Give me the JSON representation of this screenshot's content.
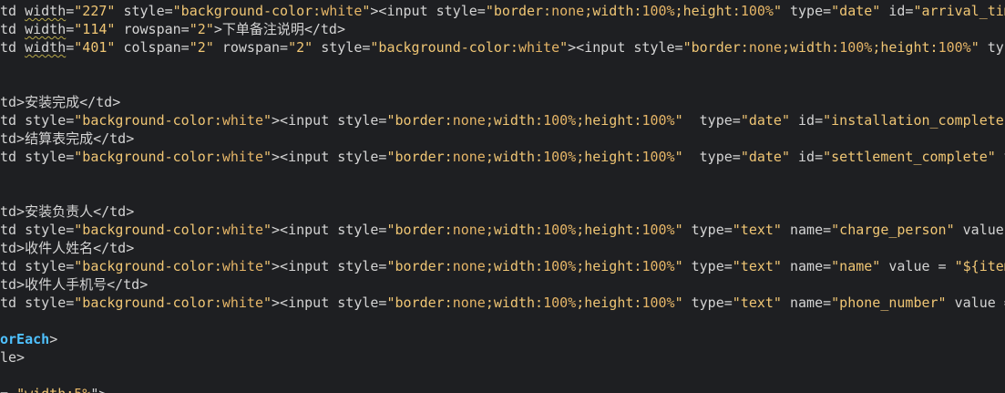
{
  "editor": {
    "background": "#1e1f22",
    "colors": {
      "default": "#d4d4d4",
      "string": "#f0c674",
      "jstl_tag": "#4fc1ff"
    },
    "lines": [
      {
        "row": 0,
        "tokens": [
          {
            "t": "td ",
            "c": "tag"
          },
          {
            "t": "width",
            "c": "attr",
            "squiggle": true
          },
          {
            "t": "=",
            "c": "tag"
          },
          {
            "t": "\"227\"",
            "c": "str"
          },
          {
            "t": " style=",
            "c": "attr"
          },
          {
            "t": "\"background-color:",
            "c": "str"
          },
          {
            "t": "white",
            "c": "kw"
          },
          {
            "t": "\"",
            "c": "str"
          },
          {
            "t": "><input style=",
            "c": "tag"
          },
          {
            "t": "\"border:",
            "c": "str"
          },
          {
            "t": "none",
            "c": "kw"
          },
          {
            "t": ";width:",
            "c": "str"
          },
          {
            "t": "100%",
            "c": "kw"
          },
          {
            "t": ";height:",
            "c": "str"
          },
          {
            "t": "100%",
            "c": "kw"
          },
          {
            "t": "\"",
            "c": "str"
          },
          {
            "t": " type=",
            "c": "attr"
          },
          {
            "t": "\"date\"",
            "c": "str"
          },
          {
            "t": " id=",
            "c": "attr"
          },
          {
            "t": "\"arrival_tim",
            "c": "str"
          }
        ]
      },
      {
        "row": 1,
        "tokens": [
          {
            "t": "td ",
            "c": "tag"
          },
          {
            "t": "width",
            "c": "attr",
            "squiggle": true
          },
          {
            "t": "=",
            "c": "tag"
          },
          {
            "t": "\"114\"",
            "c": "str"
          },
          {
            "t": " rowspan=",
            "c": "attr"
          },
          {
            "t": "\"2\"",
            "c": "str"
          },
          {
            "t": ">下单备注说明</td>",
            "c": "tag"
          }
        ]
      },
      {
        "row": 2,
        "tokens": [
          {
            "t": "td ",
            "c": "tag"
          },
          {
            "t": "width",
            "c": "attr",
            "squiggle": true
          },
          {
            "t": "=",
            "c": "tag"
          },
          {
            "t": "\"401\"",
            "c": "str"
          },
          {
            "t": " colspan=",
            "c": "attr"
          },
          {
            "t": "\"2\"",
            "c": "str"
          },
          {
            "t": " rowspan=",
            "c": "attr"
          },
          {
            "t": "\"2\"",
            "c": "str"
          },
          {
            "t": " style=",
            "c": "attr"
          },
          {
            "t": "\"background-color:",
            "c": "str"
          },
          {
            "t": "white",
            "c": "kw"
          },
          {
            "t": "\"",
            "c": "str"
          },
          {
            "t": "><input style=",
            "c": "tag"
          },
          {
            "t": "\"border:",
            "c": "str"
          },
          {
            "t": "none",
            "c": "kw"
          },
          {
            "t": ";width:",
            "c": "str"
          },
          {
            "t": "100%",
            "c": "kw"
          },
          {
            "t": ";height:",
            "c": "str"
          },
          {
            "t": "100%",
            "c": "kw"
          },
          {
            "t": "\"",
            "c": "str"
          },
          {
            "t": " typ",
            "c": "attr"
          }
        ]
      },
      {
        "row": 5,
        "tokens": [
          {
            "t": "td>安装完成</td>",
            "c": "tag"
          }
        ]
      },
      {
        "row": 6,
        "tokens": [
          {
            "t": "td style=",
            "c": "tag"
          },
          {
            "t": "\"background-color:",
            "c": "str"
          },
          {
            "t": "white",
            "c": "kw"
          },
          {
            "t": "\"",
            "c": "str"
          },
          {
            "t": "><input style=",
            "c": "tag"
          },
          {
            "t": "\"border:",
            "c": "str"
          },
          {
            "t": "none",
            "c": "kw"
          },
          {
            "t": ";width:",
            "c": "str"
          },
          {
            "t": "100%",
            "c": "kw"
          },
          {
            "t": ";height:",
            "c": "str"
          },
          {
            "t": "100%",
            "c": "kw"
          },
          {
            "t": "\"",
            "c": "str"
          },
          {
            "t": "  type=",
            "c": "attr"
          },
          {
            "t": "\"date\"",
            "c": "str"
          },
          {
            "t": " id=",
            "c": "attr"
          },
          {
            "t": "\"installation_complete\"",
            "c": "str"
          }
        ]
      },
      {
        "row": 7,
        "tokens": [
          {
            "t": "td>结算表完成</td>",
            "c": "tag"
          }
        ]
      },
      {
        "row": 8,
        "tokens": [
          {
            "t": "td style=",
            "c": "tag"
          },
          {
            "t": "\"background-color:",
            "c": "str"
          },
          {
            "t": "white",
            "c": "kw"
          },
          {
            "t": "\"",
            "c": "str"
          },
          {
            "t": "><input style=",
            "c": "tag"
          },
          {
            "t": "\"border:",
            "c": "str"
          },
          {
            "t": "none",
            "c": "kw"
          },
          {
            "t": ";width:",
            "c": "str"
          },
          {
            "t": "100%",
            "c": "kw"
          },
          {
            "t": ";height:",
            "c": "str"
          },
          {
            "t": "100%",
            "c": "kw"
          },
          {
            "t": "\"",
            "c": "str"
          },
          {
            "t": "  type=",
            "c": "attr"
          },
          {
            "t": "\"date\"",
            "c": "str"
          },
          {
            "t": " id=",
            "c": "attr"
          },
          {
            "t": "\"settlement_complete\"",
            "c": "str"
          },
          {
            "t": " v",
            "c": "attr"
          }
        ]
      },
      {
        "row": 11,
        "tokens": [
          {
            "t": "td>安装负责人</td>",
            "c": "tag"
          }
        ]
      },
      {
        "row": 12,
        "tokens": [
          {
            "t": "td style=",
            "c": "tag"
          },
          {
            "t": "\"background-color:",
            "c": "str"
          },
          {
            "t": "white",
            "c": "kw"
          },
          {
            "t": "\"",
            "c": "str"
          },
          {
            "t": "><input style=",
            "c": "tag"
          },
          {
            "t": "\"border:",
            "c": "str"
          },
          {
            "t": "none",
            "c": "kw"
          },
          {
            "t": ";width:",
            "c": "str"
          },
          {
            "t": "100%",
            "c": "kw"
          },
          {
            "t": ";height:",
            "c": "str"
          },
          {
            "t": "100%",
            "c": "kw"
          },
          {
            "t": "\"",
            "c": "str"
          },
          {
            "t": " type=",
            "c": "attr"
          },
          {
            "t": "\"text\"",
            "c": "str"
          },
          {
            "t": " name=",
            "c": "attr"
          },
          {
            "t": "\"charge_person\"",
            "c": "str"
          },
          {
            "t": " value",
            "c": "attr"
          }
        ]
      },
      {
        "row": 13,
        "tokens": [
          {
            "t": "td>收件人姓名</td>",
            "c": "tag"
          }
        ]
      },
      {
        "row": 14,
        "tokens": [
          {
            "t": "td style=",
            "c": "tag"
          },
          {
            "t": "\"background-color:",
            "c": "str"
          },
          {
            "t": "white",
            "c": "kw"
          },
          {
            "t": "\"",
            "c": "str"
          },
          {
            "t": "><input style=",
            "c": "tag"
          },
          {
            "t": "\"border:",
            "c": "str"
          },
          {
            "t": "none",
            "c": "kw"
          },
          {
            "t": ";width:",
            "c": "str"
          },
          {
            "t": "100%",
            "c": "kw"
          },
          {
            "t": ";height:",
            "c": "str"
          },
          {
            "t": "100%",
            "c": "kw"
          },
          {
            "t": "\"",
            "c": "str"
          },
          {
            "t": " type=",
            "c": "attr"
          },
          {
            "t": "\"text\"",
            "c": "str"
          },
          {
            "t": " name=",
            "c": "attr"
          },
          {
            "t": "\"name\"",
            "c": "str"
          },
          {
            "t": " value = ",
            "c": "attr"
          },
          {
            "t": "\"${item",
            "c": "str"
          }
        ]
      },
      {
        "row": 15,
        "tokens": [
          {
            "t": "td>收件人手机号</td>",
            "c": "tag"
          }
        ]
      },
      {
        "row": 16,
        "tokens": [
          {
            "t": "td style=",
            "c": "tag"
          },
          {
            "t": "\"background-color:",
            "c": "str"
          },
          {
            "t": "white",
            "c": "kw"
          },
          {
            "t": "\"",
            "c": "str"
          },
          {
            "t": "><input style=",
            "c": "tag"
          },
          {
            "t": "\"border:",
            "c": "str"
          },
          {
            "t": "none",
            "c": "kw"
          },
          {
            "t": ";width:",
            "c": "str"
          },
          {
            "t": "100%",
            "c": "kw"
          },
          {
            "t": ";height:",
            "c": "str"
          },
          {
            "t": "100%",
            "c": "kw"
          },
          {
            "t": "\"",
            "c": "str"
          },
          {
            "t": " type=",
            "c": "attr"
          },
          {
            "t": "\"text\"",
            "c": "str"
          },
          {
            "t": " name=",
            "c": "attr"
          },
          {
            "t": "\"phone_number\"",
            "c": "str"
          },
          {
            "t": " value =",
            "c": "attr"
          }
        ]
      },
      {
        "row": 18,
        "tokens": [
          {
            "t": "orEach",
            "c": "jstl"
          },
          {
            "t": ">",
            "c": "tag"
          }
        ]
      },
      {
        "row": 19,
        "tokens": [
          {
            "t": "le>",
            "c": "tag"
          }
        ]
      },
      {
        "row": 21,
        "tokens": [
          {
            "t": "= ",
            "c": "tag"
          },
          {
            "t": "\"width:",
            "c": "str"
          },
          {
            "t": "5%",
            "c": "kw"
          },
          {
            "t": "\">",
            "c": "tag"
          }
        ]
      }
    ]
  }
}
